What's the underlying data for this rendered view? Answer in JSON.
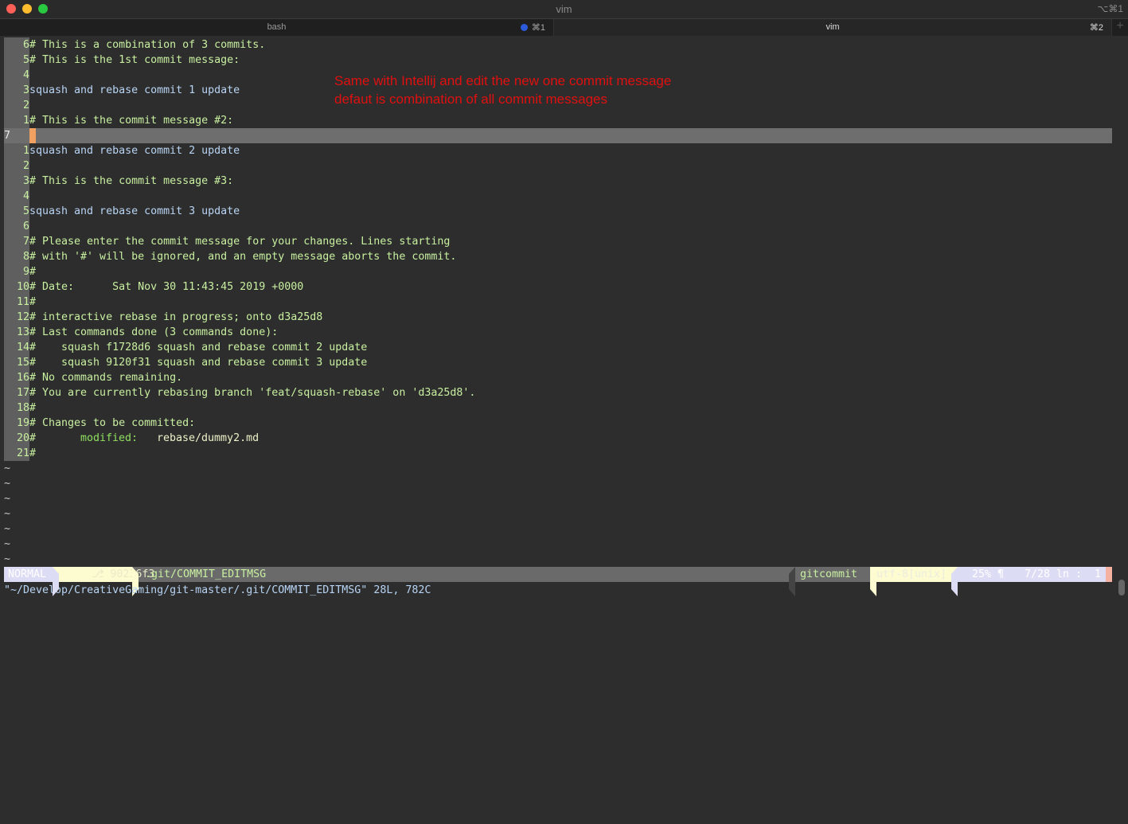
{
  "window": {
    "title": "vim",
    "shortcut": "⌥⌘1"
  },
  "tabs": [
    {
      "label": "bash",
      "key": "⌘1",
      "active": false
    },
    {
      "label": "vim",
      "key": "⌘2",
      "active": true
    }
  ],
  "annotation": {
    "line1": "Same with Intellij and edit the new one commit message",
    "line2": "defaut is combination of all commit messages",
    "color": "#e01010"
  },
  "lines": [
    {
      "num": "6",
      "text": "# This is a combination of 3 commits.",
      "type": "comment"
    },
    {
      "num": "5",
      "text": "# This is the 1st commit message:",
      "type": "comment"
    },
    {
      "num": "4",
      "text": "",
      "type": "comment"
    },
    {
      "num": "3",
      "text": "squash and rebase commit 1 update",
      "type": "msg"
    },
    {
      "num": "2",
      "text": "",
      "type": "comment"
    },
    {
      "num": "1",
      "text": "# This is the commit message #2:",
      "type": "comment"
    },
    {
      "num": "7",
      "text": "",
      "type": "cursor"
    },
    {
      "num": "1",
      "text": "squash and rebase commit 2 update",
      "type": "msg"
    },
    {
      "num": "2",
      "text": "",
      "type": "comment"
    },
    {
      "num": "3",
      "text": "# This is the commit message #3:",
      "type": "comment"
    },
    {
      "num": "4",
      "text": "",
      "type": "comment"
    },
    {
      "num": "5",
      "text": "squash and rebase commit 3 update",
      "type": "msg"
    },
    {
      "num": "6",
      "text": "",
      "type": "comment"
    },
    {
      "num": "7",
      "text": "# Please enter the commit message for your changes. Lines starting",
      "type": "comment"
    },
    {
      "num": "8",
      "text": "# with '#' will be ignored, and an empty message aborts the commit.",
      "type": "comment"
    },
    {
      "num": "9",
      "text": "#",
      "type": "comment"
    },
    {
      "num": "10",
      "text": "# Date:      Sat Nov 30 11:43:45 2019 +0000",
      "type": "comment"
    },
    {
      "num": "11",
      "text": "#",
      "type": "comment"
    },
    {
      "num": "12",
      "text": "# interactive rebase in progress; onto d3a25d8",
      "type": "comment"
    },
    {
      "num": "13",
      "text": "# Last commands done (3 commands done):",
      "type": "comment"
    },
    {
      "num": "14",
      "text": "#    squash f1728d6 squash and rebase commit 2 update",
      "type": "comment"
    },
    {
      "num": "15",
      "text": "#    squash 9120f31 squash and rebase commit 3 update",
      "type": "comment"
    },
    {
      "num": "16",
      "text": "# No commands remaining.",
      "type": "comment"
    },
    {
      "num": "17",
      "text": "# You are currently rebasing branch 'feat/squash-rebase' on 'd3a25d8'.",
      "type": "comment"
    },
    {
      "num": "18",
      "text": "#",
      "type": "comment"
    },
    {
      "num": "19",
      "text": "# Changes to be committed:",
      "type": "comment"
    },
    {
      "num": "20",
      "text": "#",
      "type": "modified",
      "label": "modified:",
      "file": "rebase/dummy2.md"
    },
    {
      "num": "21",
      "text": "#",
      "type": "comment"
    }
  ],
  "tilde": "~",
  "tilde_count": 7,
  "statusline": {
    "mode": "NORMAL",
    "branch": "⎇ 90236f3",
    "file": ".git/COMMIT_EDITMSG",
    "filetype": "gitcommit",
    "encoding": "utf-8[unix]",
    "percent": "25% ¶",
    "position": "7/28 ln :  1"
  },
  "cmdline": "\"~/Develop/CreativeGaming/git-master/.git/COMMIT_EDITMSG\" 28L, 782C",
  "colors": {
    "comment": "#c8f0a0",
    "message": "#b8d4f4",
    "cursor": "#f0a060",
    "background": "#2d2d2d"
  }
}
